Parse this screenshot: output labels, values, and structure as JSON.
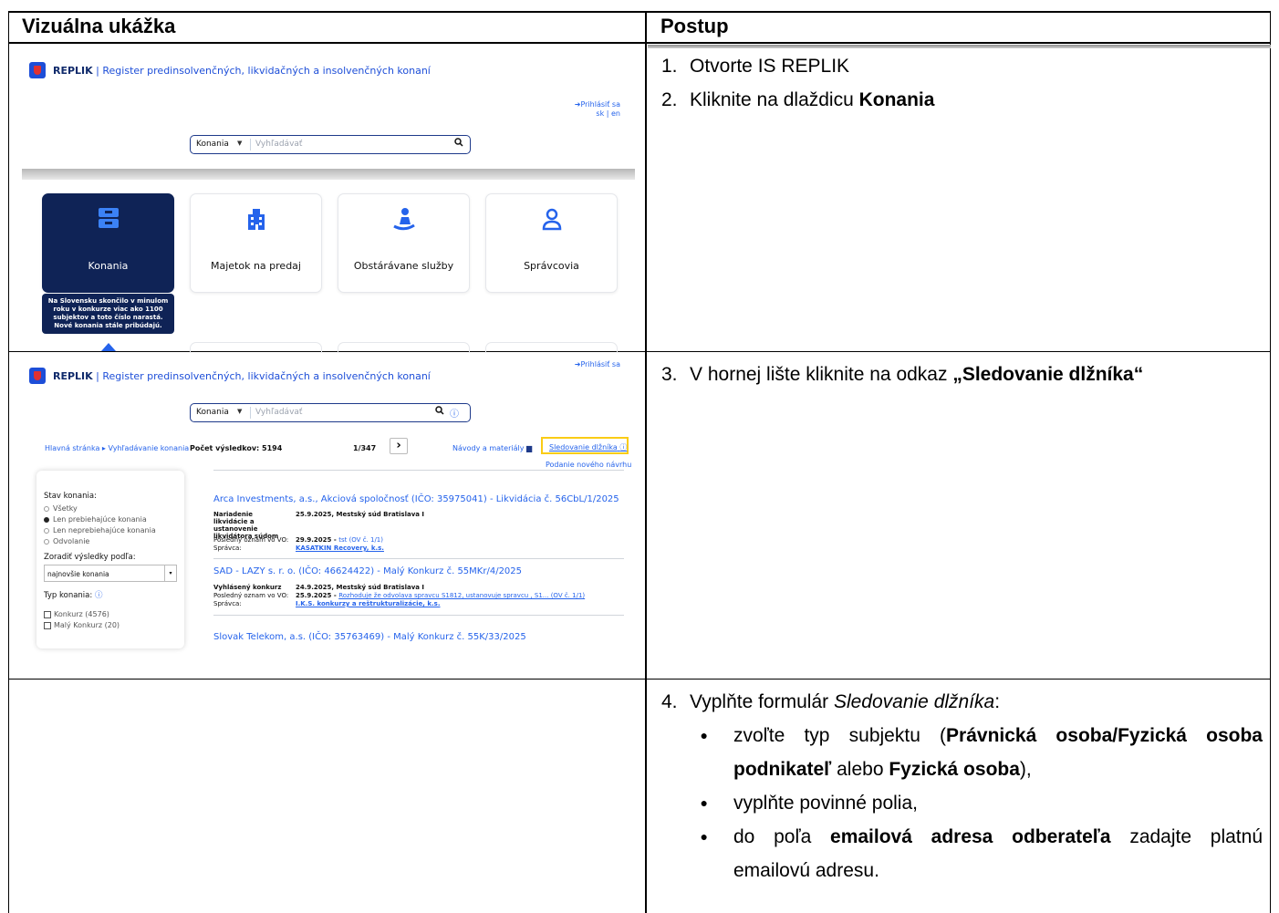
{
  "table": {
    "header_left": "Vizuálna ukážka",
    "header_right": "Postup"
  },
  "steps": {
    "s1_num": "1.",
    "s1_text": "Otvorte IS REPLIK",
    "s2_num": "2.",
    "s2_pre": "Kliknite na dlaždicu ",
    "s2_bold": "Konania",
    "s3_num": "3.",
    "s3_pre": "V hornej lište kliknite na odkaz ",
    "s3_bold": "„Sledovanie dlžníka“",
    "s4_num": "4.",
    "s4_pre": "Vyplňte formulár ",
    "s4_italic": "Sledovanie dlžníka",
    "s4_post": ":",
    "b1_pre": "zvoľte typ subjektu (",
    "b1_bold1": "Právnická osoba/Fyzická osoba podnikateľ",
    "b1_mid": " alebo ",
    "b1_bold2": "Fyzická osoba",
    "b1_post": "),",
    "b2_text": "vyplňte povinné polia,",
    "b3_pre": "do poľa ",
    "b3_bold": "emailová adresa odberateľa",
    "b3_post": " zadajte platnú emailovú adresu.",
    "bullet": "●"
  },
  "shot1": {
    "brand_bold": "REPLIK",
    "brand_rest": " | Register predinsolvenčných, likvidačných a insolvenčných konaní",
    "login": "Prihlásiť sa",
    "lang": "sk | en",
    "search_select": "Konania",
    "search_caret": "▼",
    "search_placeholder": "Vyhľadávať",
    "search_icon": "🔍",
    "tiles": [
      "Konania",
      "Majetok na predaj",
      "Obstárávane služby",
      "Správcovia"
    ],
    "tooltip": "Na Slovensku skončilo v minulom roku v konkurze viac ako 1100 subjektov a toto číslo narastá. Nové konania stále pribúdajú."
  },
  "shot2": {
    "brand_bold": "REPLIK",
    "brand_rest": " | Register predinsolvenčných, likvidačných a insolvenčných konaní",
    "login": "Prihlásiť sa",
    "search_select": "Konania",
    "search_caret": "▼",
    "search_placeholder": "Vyhľadávať",
    "breadcrumb": "Hlavná stránka ▸ Vyhľadávanie konania",
    "count_label": "Počet výsledkov: 5194",
    "page": "1/347",
    "next": "›",
    "guides": "Návody a materiály",
    "track": "Sledovanie dlžníka",
    "new_proposal": "Podanie nového návrhu",
    "filters": {
      "state_label": "Stav konania:",
      "opts": [
        "Všetky",
        "Len prebiehajúce konania",
        "Len neprebiehajúce konania",
        "Odvolanie"
      ],
      "sort_label": "Zoradiť výsledky podľa:",
      "sort_value": "najnovšie konania",
      "type_label": "Typ konania:",
      "types": [
        "Konkurz (4576)",
        "Malý Konkurz (20)"
      ]
    },
    "results": [
      {
        "title": "Arca Investments, a.s., Akciová spoločnosť (IČO: 35975041) - Likvidácia č. 56CbL/1/2025",
        "r1_label": "Nariadenie likvidácie a ustanovenie likvidátora súdom",
        "r1_value": "25.9.2025, Mestský súd Bratislava I",
        "r2_label": "Posledný oznam vo VO:",
        "r2_date": "29.9.2025 - ",
        "r2_value": "tst (OV č. 1/1)",
        "r3_label": "Správca:",
        "r3_value": "KASATKIN Recovery, k.s."
      },
      {
        "title": "SAD - LAZY s. r. o. (IČO: 46624422) - Malý Konkurz č. 55MKr/4/2025",
        "r1_label": "Vyhlásený konkurz",
        "r1_value": "24.9.2025, Mestský súd Bratislava I",
        "r2_label": "Posledný oznam vo VO:",
        "r2_date": "25.9.2025 - ",
        "r2_value": "Rozhoduje že odvolava spravcu S1812, ustanovuje spravcu , S1... (OV č. 1/1)",
        "r3_label": "Správca:",
        "r3_value": "I.K.S. konkurzy a reštrukturalizácie, k.s."
      },
      {
        "title": "Slovak Telekom, a.s. (IČO: 35763469) - Malý Konkurz č. 55K/33/2025"
      }
    ]
  }
}
